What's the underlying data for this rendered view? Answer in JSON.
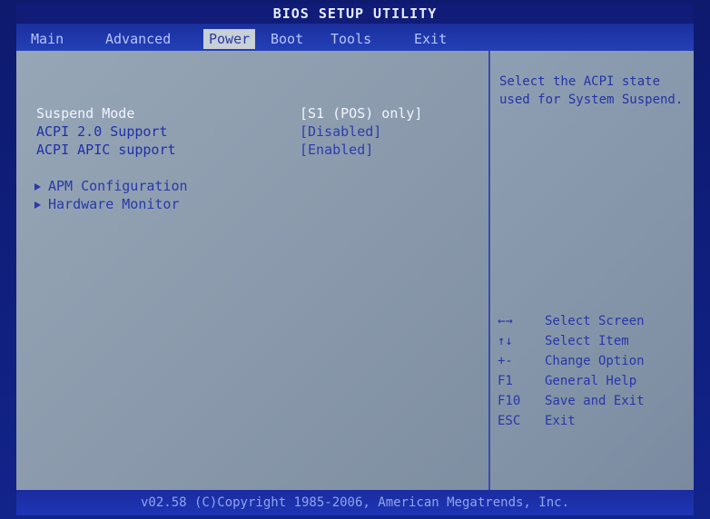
{
  "title": "BIOS SETUP UTILITY",
  "tabs": [
    {
      "label": "Main"
    },
    {
      "label": "Advanced"
    },
    {
      "label": "Power"
    },
    {
      "label": "Boot"
    },
    {
      "label": "Tools"
    },
    {
      "label": "Exit"
    }
  ],
  "active_tab": "Power",
  "settings": [
    {
      "label": "Suspend Mode",
      "value": "[S1 (POS) only]"
    },
    {
      "label": "ACPI 2.0 Support",
      "value": "[Disabled]"
    },
    {
      "label": "ACPI APIC support",
      "value": "[Enabled]"
    }
  ],
  "submenus": [
    {
      "label": "APM Configuration"
    },
    {
      "label": "Hardware Monitor"
    }
  ],
  "help": {
    "description": "Select the ACPI state used for System Suspend."
  },
  "keys": [
    {
      "key": "←→",
      "desc": "Select Screen"
    },
    {
      "key": "↑↓",
      "desc": "Select Item"
    },
    {
      "key": "+-",
      "desc": "Change Option"
    },
    {
      "key": "F1",
      "desc": "General Help"
    },
    {
      "key": "F10",
      "desc": "Save and Exit"
    },
    {
      "key": "ESC",
      "desc": "Exit"
    }
  ],
  "footer": "v02.58 (C)Copyright 1985-2006, American Megatrends, Inc.",
  "colors": {
    "background": "#12238a",
    "panel": "#8a9aac",
    "highlight_text": "#f2f4ff",
    "normal_text": "#2030a8"
  }
}
